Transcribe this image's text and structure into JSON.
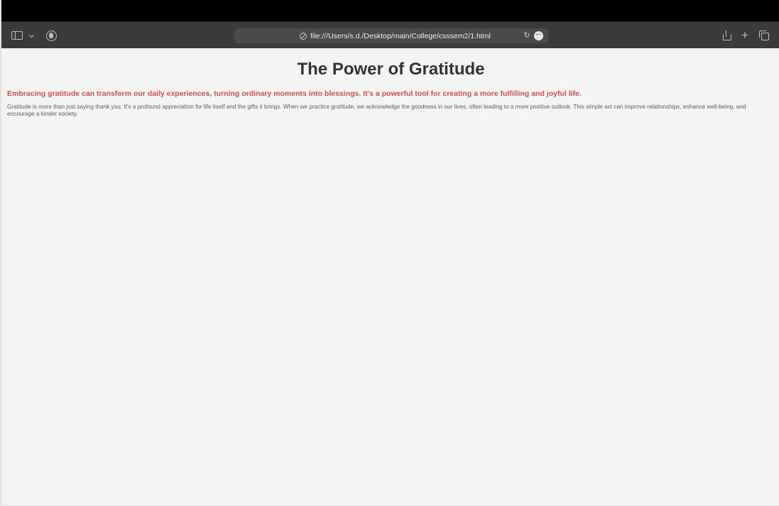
{
  "browser": {
    "url": "file:///Users/s.d./Desktop/main/College/csssem2/1.html",
    "icons": [
      "sidebar-icon",
      "chevron-down-icon",
      "privacy-report-icon",
      "compass-icon",
      "reload-icon",
      "more-icon",
      "share-icon",
      "plus-icon",
      "tabs-overview-icon"
    ]
  },
  "page": {
    "title": "The Power of Gratitude",
    "lead": "Embracing gratitude can transform our daily experiences, turning ordinary moments into blessings. It's a powerful tool for creating a more fulfilling and joyful life.",
    "body": "Gratitude is more than just saying thank you. It's a profound appreciation for life itself and the gifts it brings. When we practice gratitude, we acknowledge the goodness in our lives, often leading to a more positive outlook. This simple act can improve relationships, enhance well-being, and encourage a kinder society."
  },
  "colors": {
    "accent_red": "#e84a4a",
    "title": "#333333",
    "page_background": "#f4f4f4",
    "toolbar": "#3a3a38"
  }
}
